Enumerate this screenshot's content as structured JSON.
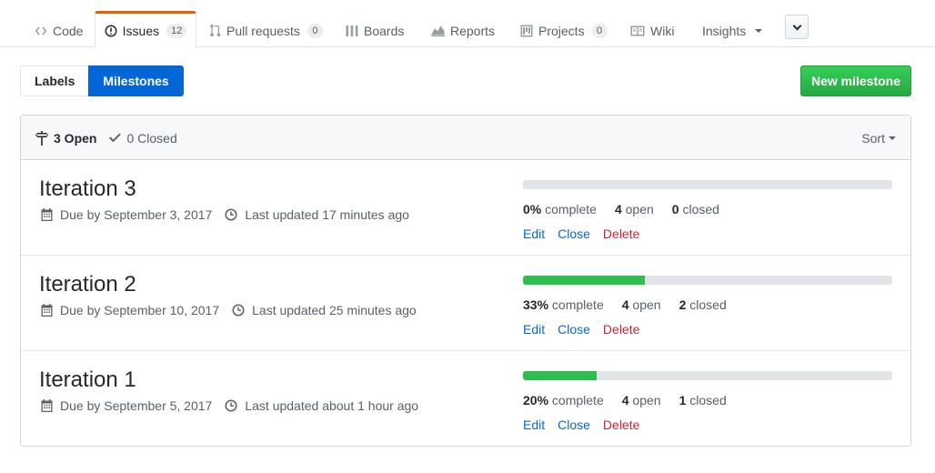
{
  "reponav": {
    "tabs": [
      {
        "label": "Code",
        "icon": "code-icon"
      },
      {
        "label": "Issues",
        "icon": "issue-opened-icon",
        "counter": "12",
        "selected": true
      },
      {
        "label": "Pull requests",
        "icon": "git-pull-request-icon",
        "counter": "0"
      },
      {
        "label": "Boards",
        "icon": "boards-icon"
      },
      {
        "label": "Reports",
        "icon": "graph-icon"
      },
      {
        "label": "Projects",
        "icon": "project-icon",
        "counter": "0"
      },
      {
        "label": "Wiki",
        "icon": "book-icon"
      },
      {
        "label": "Insights"
      }
    ]
  },
  "subnav": {
    "labels": "Labels",
    "milestones": "Milestones"
  },
  "new_milestone_label": "New milestone",
  "filters": {
    "open": "3 Open",
    "closed": "0 Closed",
    "sort": "Sort"
  },
  "milestones": [
    {
      "title": "Iteration 3",
      "due": "Due by September 3, 2017",
      "updated": "Last updated 17 minutes ago",
      "percent": 0,
      "percent_label": "0%",
      "complete_word": "complete",
      "open_count": "4",
      "open_word": "open",
      "closed_count": "0",
      "closed_word": "closed"
    },
    {
      "title": "Iteration 2",
      "due": "Due by September 10, 2017",
      "updated": "Last updated 25 minutes ago",
      "percent": 33,
      "percent_label": "33%",
      "complete_word": "complete",
      "open_count": "4",
      "open_word": "open",
      "closed_count": "2",
      "closed_word": "closed"
    },
    {
      "title": "Iteration 1",
      "due": "Due by September 5, 2017",
      "updated": "Last updated about 1 hour ago",
      "percent": 20,
      "percent_label": "20%",
      "complete_word": "complete",
      "open_count": "4",
      "open_word": "open",
      "closed_count": "1",
      "closed_word": "closed"
    }
  ],
  "actions": {
    "edit": "Edit",
    "close": "Close",
    "delete": "Delete"
  },
  "colors": {
    "accent_tab": "#e36209",
    "primary": "#0366d6",
    "progress": "#2cbe4e",
    "danger": "#cb2431",
    "new_button": "#28a745"
  }
}
